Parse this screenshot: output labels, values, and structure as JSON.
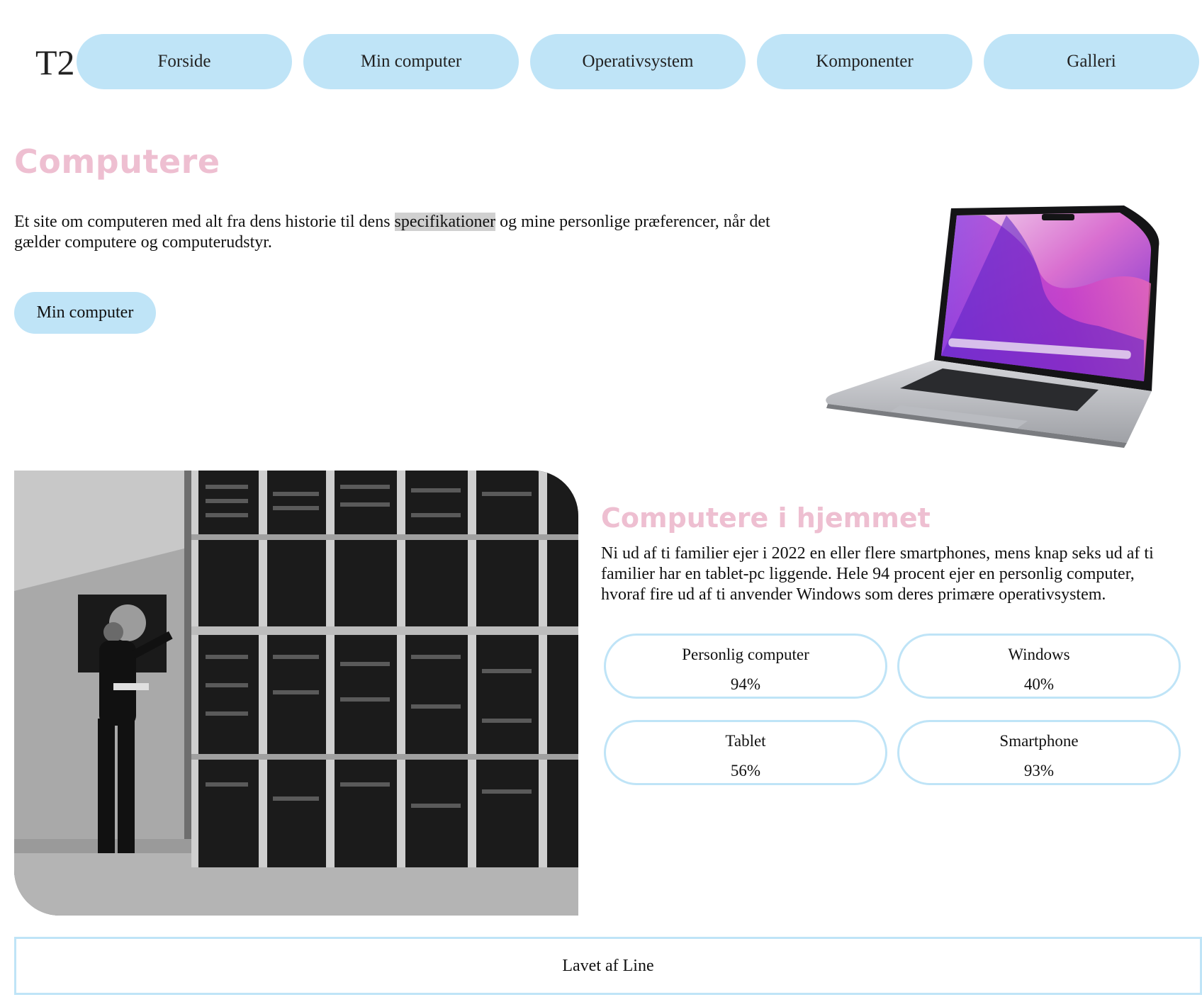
{
  "colors": {
    "accent_blue": "#bfe4f7",
    "heading_pink": "#eebfd1",
    "text": "#111111"
  },
  "header": {
    "logo": "T2",
    "nav": [
      {
        "label": "Forside"
      },
      {
        "label": "Min computer"
      },
      {
        "label": "Operativsystem"
      },
      {
        "label": "Komponenter"
      },
      {
        "label": "Galleri"
      }
    ]
  },
  "hero": {
    "title": "Computere",
    "text_before": "Et site om computeren med alt fra dens historie til dens ",
    "text_highlight": "specifikationer",
    "text_after": " og mine personlige præferencer, når det gælder computere og computerudstyr.",
    "button_label": "Min computer",
    "image_icon": "laptop-image"
  },
  "home": {
    "image_icon": "mainframe-photo",
    "title": "Computere i hjemmet",
    "text": "Ni ud af ti familier ejer i 2022 en eller flere smartphones, mens knap seks ud af ti familier har en tablet-pc liggende. Hele 94 procent ejer en personlig computer, hvoraf fire ud af ti anvender Windows som deres primære operativsystem.",
    "stats": [
      {
        "label": "Personlig computer",
        "value": "94%"
      },
      {
        "label": "Windows",
        "value": "40%"
      },
      {
        "label": "Tablet",
        "value": "56%"
      },
      {
        "label": "Smartphone",
        "value": "93%"
      }
    ]
  },
  "footer": {
    "text": "Lavet af Line"
  }
}
